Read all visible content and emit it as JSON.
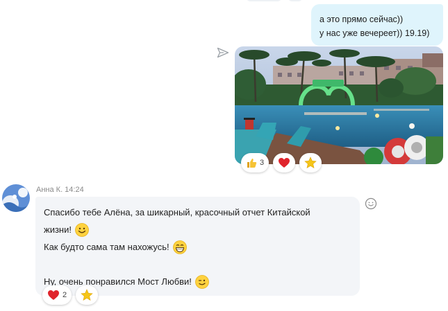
{
  "outgoing": {
    "lines": [
      "а это прямо сейчас))",
      "у нас уже вечереет)) 19.19)"
    ]
  },
  "photo_message": {
    "reactions": [
      {
        "icon": "thumbs-up-icon",
        "count": "3"
      },
      {
        "icon": "heart-icon",
        "count": ""
      },
      {
        "icon": "star-icon",
        "count": ""
      }
    ]
  },
  "incoming": {
    "sender": "Анна К.",
    "time": "14:24",
    "sender_line": "Анна К. 14:24",
    "lines": [
      {
        "text": "Спасибо тебе Алёна, за шикарный, красочный отчет Китайской",
        "emoji": ""
      },
      {
        "text": "жизни!",
        "emoji": "smile-emoji"
      },
      {
        "text": "Как будто сама там нахожусь!",
        "emoji": "laugh-emoji"
      },
      {
        "text": "",
        "emoji": ""
      },
      {
        "text": "Ну, очень понравился Мост Любви!",
        "emoji": "wink-emoji"
      }
    ],
    "reactions": [
      {
        "icon": "heart-icon",
        "count": "2"
      },
      {
        "icon": "star-icon",
        "count": ""
      }
    ]
  },
  "colors": {
    "outgoing_bubble": "#dff4fc",
    "incoming_bubble": "#f3f5f8",
    "meta_text": "#8a8a8a"
  }
}
